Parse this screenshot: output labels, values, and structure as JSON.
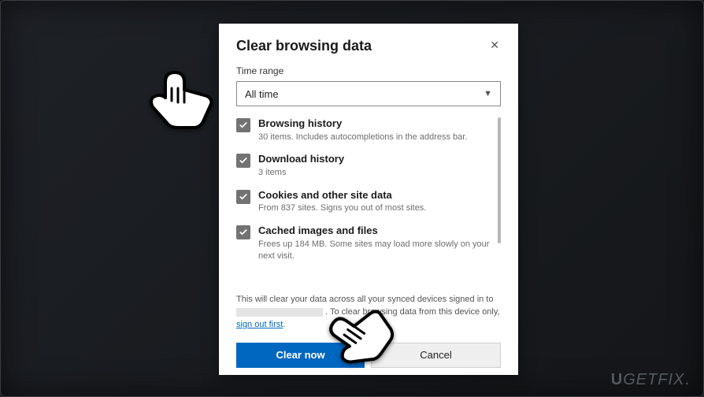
{
  "dialog": {
    "title": "Clear browsing data",
    "close_glyph": "✕",
    "time_range_label": "Time range",
    "time_range_value": "All time"
  },
  "options": [
    {
      "title": "Browsing history",
      "sub": "30 items. Includes autocompletions in the address bar."
    },
    {
      "title": "Download history",
      "sub": "3 items"
    },
    {
      "title": "Cookies and other site data",
      "sub": "From 837 sites. Signs you out of most sites."
    },
    {
      "title": "Cached images and files",
      "sub": "Frees up 184 MB. Some sites may load more slowly on your next visit."
    }
  ],
  "sync_notice": {
    "part1": "This will clear your data across all your synced devices signed in to ",
    "part2": ". To clear browsing data from this device only, ",
    "link": "sign out first",
    "part3": "."
  },
  "buttons": {
    "primary": "Clear now",
    "secondary": "Cancel"
  },
  "watermark": "UGETFIX"
}
